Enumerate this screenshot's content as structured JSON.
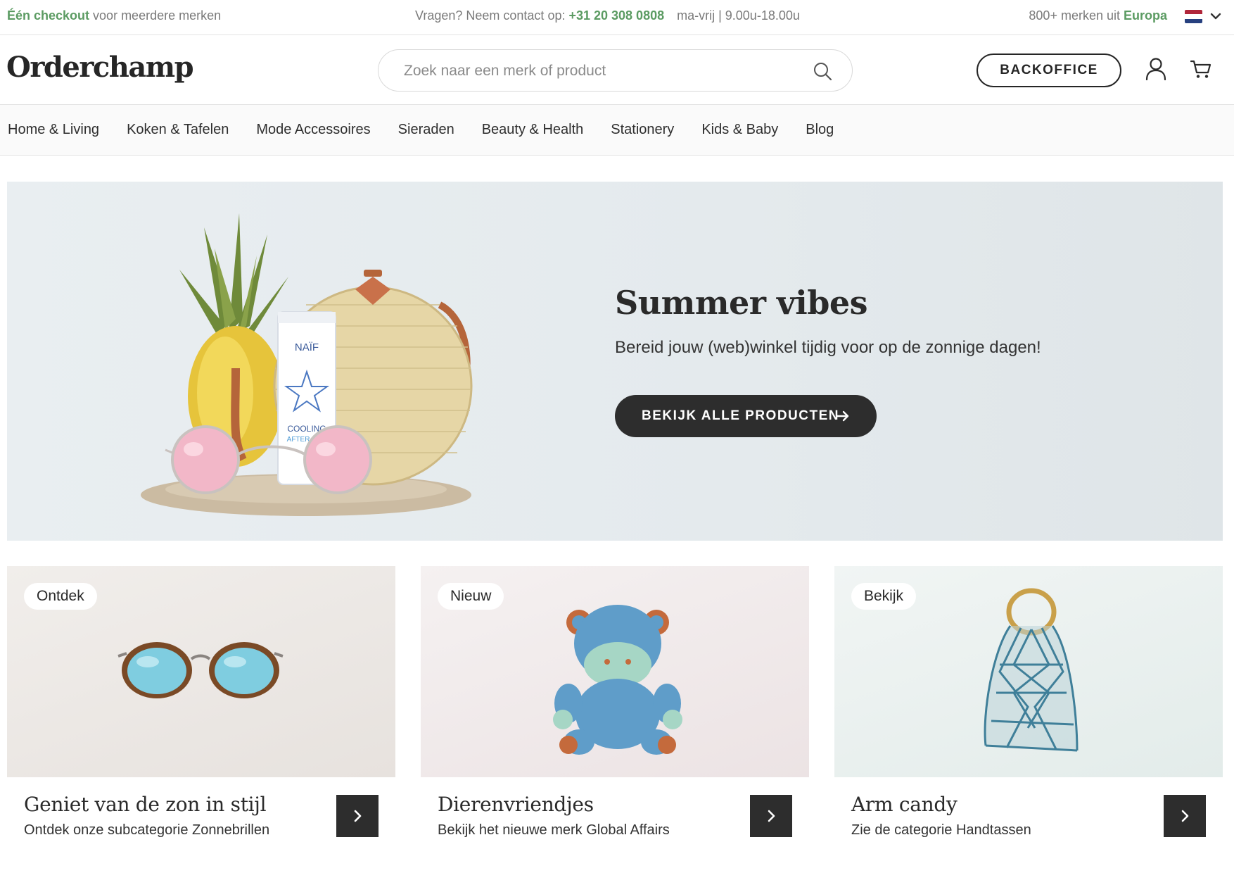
{
  "topbar": {
    "checkout_strong": "Één checkout",
    "checkout_rest": " voor meerdere merken",
    "contact_prefix": "Vragen? Neem contact op: ",
    "phone": "+31 20 308 0808",
    "hours": "ma-vrij | 9.00u-18.00u",
    "brands_prefix": "800+ merken uit ",
    "brands_region": "Europa",
    "language_flag": "flag-netherlands",
    "accent_color": "#5b9b62"
  },
  "header": {
    "logo": "Orderchamp",
    "search_placeholder": "Zoek naar een merk of product",
    "backoffice_label": "BACKOFFICE",
    "icons": [
      "search-icon",
      "user-icon",
      "cart-icon"
    ]
  },
  "nav": {
    "items": [
      "Home & Living",
      "Koken & Tafelen",
      "Mode Accessoires",
      "Sieraden",
      "Beauty & Health",
      "Stationery",
      "Kids & Baby",
      "Blog"
    ]
  },
  "hero": {
    "title": "Summer vibes",
    "subtitle": "Bereid jouw (web)winkel tijdig voor op de zonnige dagen!",
    "cta_label": "BEKIJK ALLE PRODUCTEN",
    "product_label_1": "NAÏF",
    "product_label_2": "COOLING",
    "product_label_3": "AFTER SUN"
  },
  "cards": [
    {
      "badge": "Ontdek",
      "title": "Geniet van de zon in stijl",
      "subtitle": "Ontdek onze subcategorie Zonnebrillen"
    },
    {
      "badge": "Nieuw",
      "title": "Dierenvriendjes",
      "subtitle": "Bekijk het nieuwe merk Global Affairs"
    },
    {
      "badge": "Bekijk",
      "title": "Arm candy",
      "subtitle": "Zie de categorie Handtassen"
    }
  ]
}
